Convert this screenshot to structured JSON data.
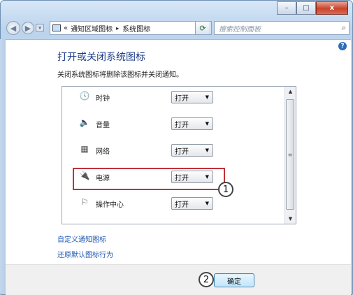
{
  "window": {
    "minimize": "–",
    "maximize": "□",
    "close": "x"
  },
  "nav": {
    "back_icon": "back-arrow",
    "forward_icon": "forward-arrow",
    "breadcrumb_prefix": "«",
    "breadcrumb": [
      "通知区域图标",
      "系统图标"
    ],
    "breadcrumb_sep": "▸",
    "search_placeholder": "搜索控制面板"
  },
  "page": {
    "title": "打开或关闭系统图标",
    "description": "关闭系统图标将删除该图标并关闭通知。",
    "help_label": "?"
  },
  "icons": [
    {
      "name": "时钟",
      "state": "打开",
      "icon": "clock-icon"
    },
    {
      "name": "音量",
      "state": "打开",
      "icon": "speaker-icon"
    },
    {
      "name": "网络",
      "state": "打开",
      "icon": "network-icon"
    },
    {
      "name": "电源",
      "state": "打开",
      "icon": "power-icon"
    },
    {
      "name": "操作中心",
      "state": "打开",
      "icon": "flag-icon"
    }
  ],
  "links": {
    "customize": "自定义通知图标",
    "restore": "还原默认图标行为"
  },
  "footer": {
    "ok": "确定"
  },
  "annotations": {
    "marker1": "1",
    "marker2": "2",
    "highlight_color": "#c0313a"
  }
}
